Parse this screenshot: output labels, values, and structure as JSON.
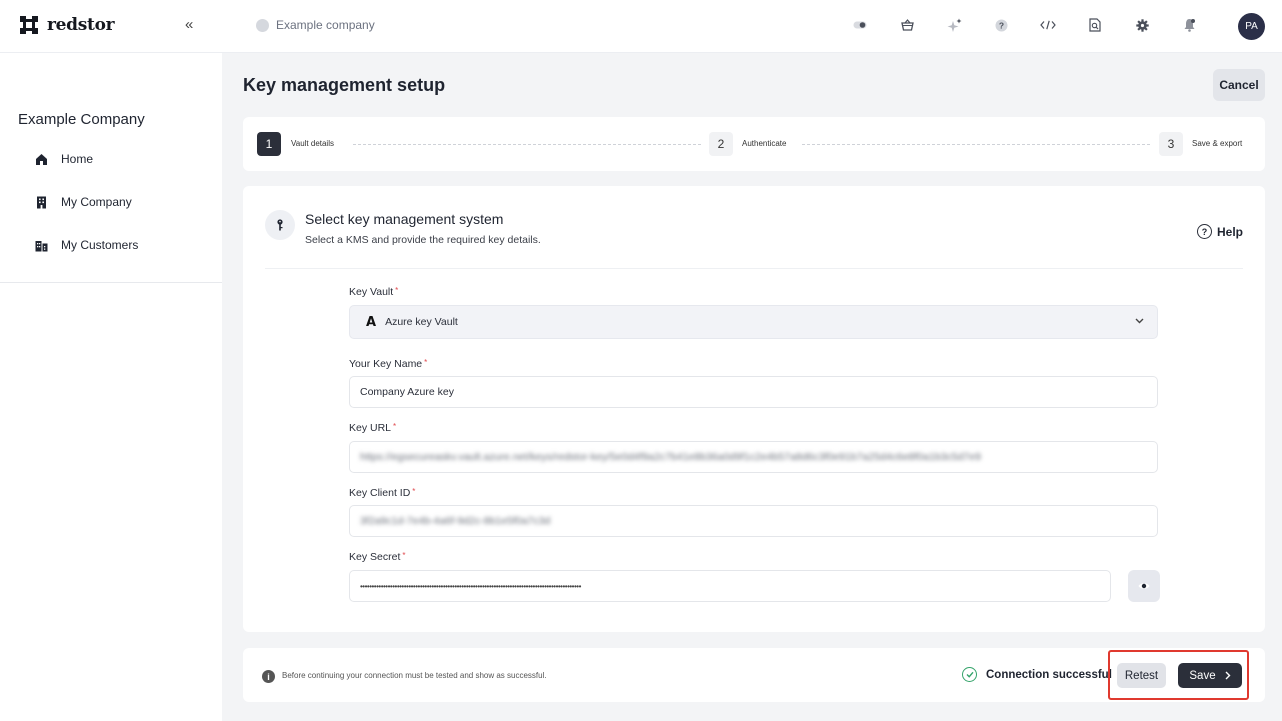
{
  "topbar": {
    "logo_text": "redstor",
    "collapse_glyph": "«",
    "company_placeholder": "Example company",
    "icons": [
      "toggle-icon",
      "basket-icon",
      "sparkle-icon",
      "help-icon",
      "code-icon",
      "search-doc-icon",
      "gear-icon",
      "bell-icon"
    ],
    "avatar_initials": "PA"
  },
  "sidebar": {
    "title": "Example Company",
    "items": [
      {
        "label": "Home",
        "icon": "home-icon"
      },
      {
        "label": "My Company",
        "icon": "building-icon"
      },
      {
        "label": "My Customers",
        "icon": "buildings-icon"
      }
    ]
  },
  "page": {
    "title": "Key management setup",
    "cancel_label": "Cancel"
  },
  "stepper": {
    "steps": [
      {
        "num": "1",
        "label": "Vault details",
        "active": true
      },
      {
        "num": "2",
        "label": "Authenticate",
        "active": false
      },
      {
        "num": "3",
        "label": "Save & export",
        "active": false
      }
    ]
  },
  "card": {
    "title": "Select key management system",
    "subtitle": "Select a KMS and provide the required key details.",
    "help_label": "Help",
    "fields": {
      "vault": {
        "label": "Key Vault",
        "required_mark": "*",
        "value": "Azure key Vault",
        "logo_glyph": "A"
      },
      "key_name": {
        "label": "Your Key Name",
        "required_mark": "*",
        "value": "Company Azure key"
      },
      "key_url": {
        "label": "Key URL",
        "required_mark": "*",
        "value": "https://egsecureaskv.vault.azure.net/keys/redstor-key/5e0d4f9a2c7b41e8b36a0d9f1c2e4b57a8d6c3f0e91b7a25d4c6e8f0a1b3c5d7e9"
      },
      "client_id": {
        "label": "Key Client ID",
        "required_mark": "*",
        "value": "3f2a9c1d-7e4b-4a6f-9d2c-8b1e5f0a7c3d"
      },
      "secret": {
        "label": "Key Secret",
        "required_mark": "*",
        "value": "••••••••••••••••••••••••••••••••••••••••••••••••••••••••••••••••••••••••••••••••••••••••••••••••"
      }
    }
  },
  "footer": {
    "info_glyph": "i",
    "note": "Before continuing your connection must be tested and show as successful.",
    "status": "Connection successful",
    "retest_label": "Retest",
    "save_label": "Save"
  }
}
